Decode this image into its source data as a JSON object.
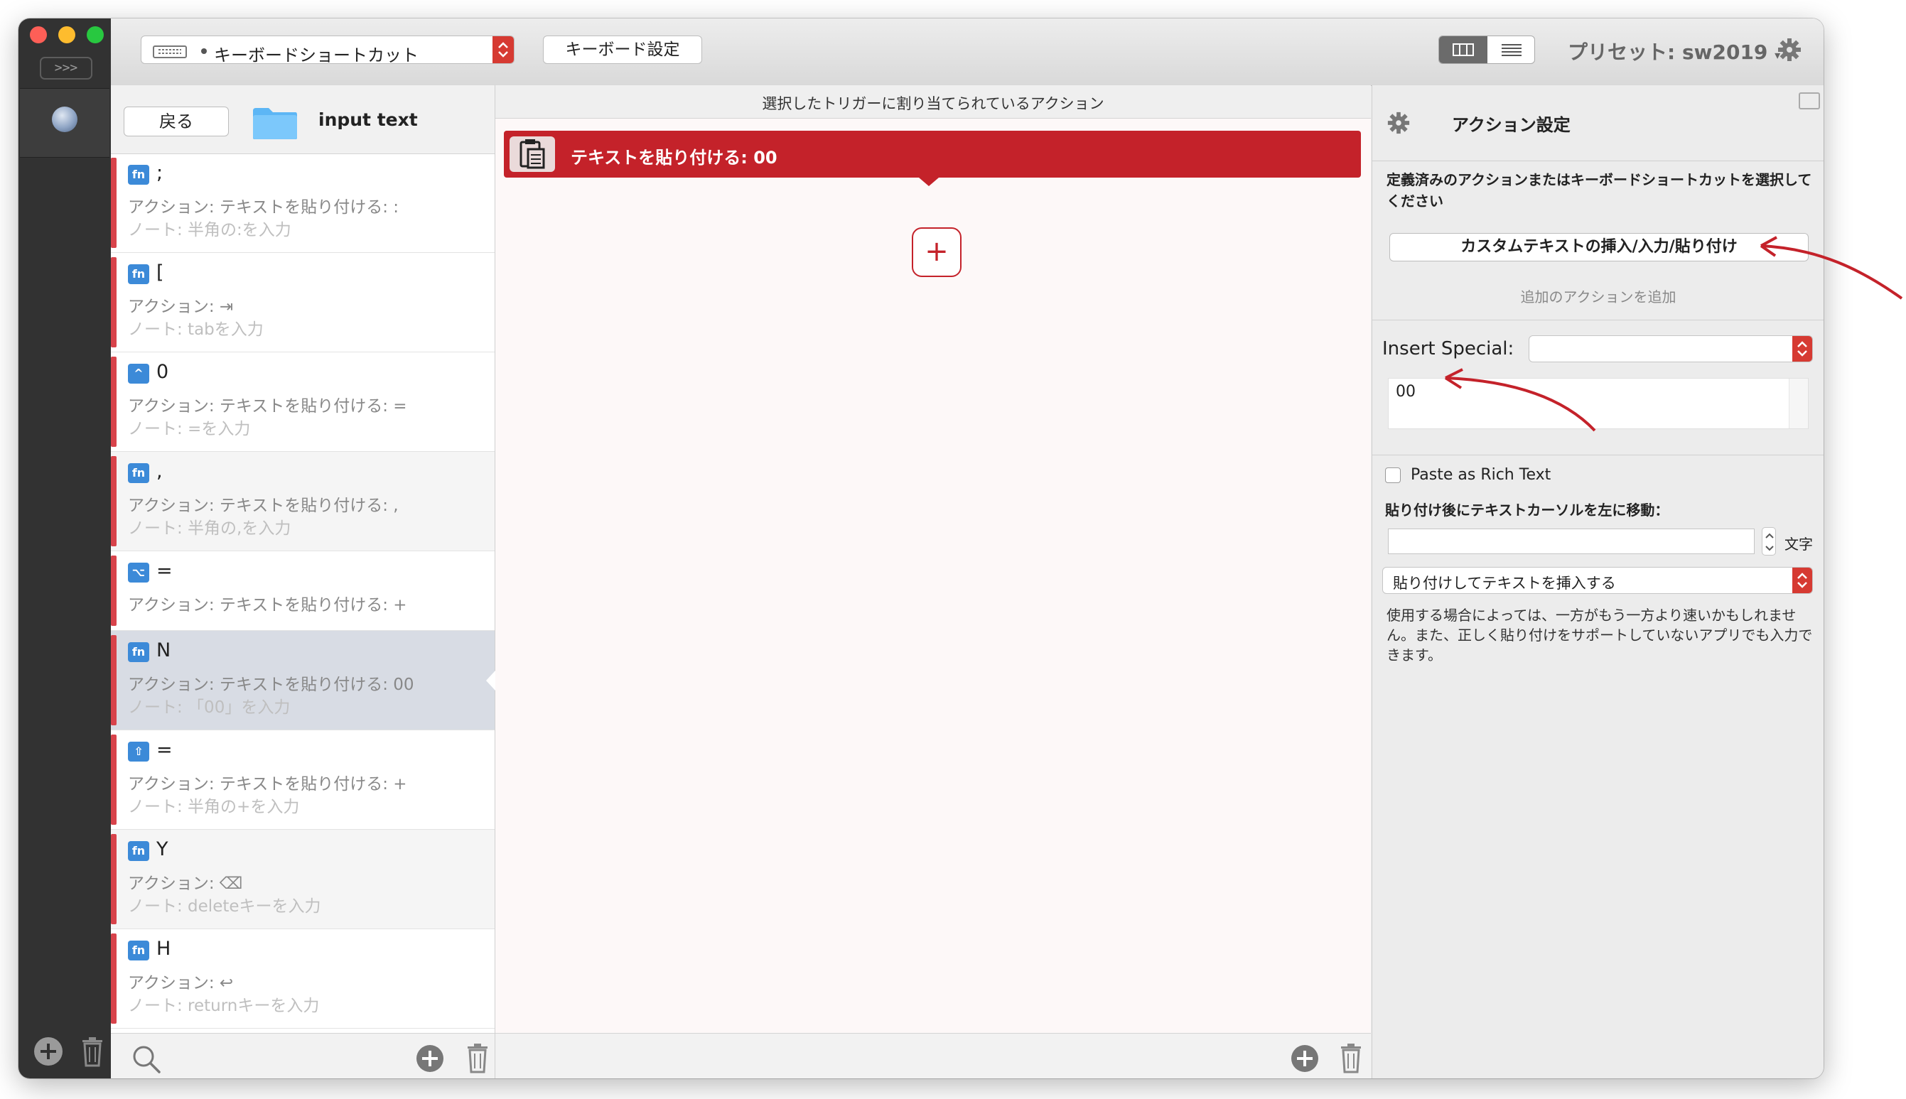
{
  "toolbar": {
    "trigger_type": "キーボードショートカット",
    "keyboard_settings": "キーボード設定",
    "preset_label": "プリセット: sw2019"
  },
  "list": {
    "back_label": "戻る",
    "folder_name": "input text",
    "items": [
      {
        "badge": "fn",
        "key": ";",
        "action": "アクション: テキストを貼り付ける: :",
        "note": "ノート: 半角の:を入力"
      },
      {
        "badge": "fn",
        "key": "[",
        "action": "アクション: ⇥",
        "note": "ノート: tabを入力"
      },
      {
        "badge": "^",
        "key": "0",
        "action": "アクション: テキストを貼り付ける: =",
        "note": "ノート: =を入力"
      },
      {
        "badge": "fn",
        "key": ",",
        "action": "アクション: テキストを貼り付ける: ,",
        "note": "ノート: 半角の,を入力"
      },
      {
        "badge": "⌥",
        "key": "=",
        "action": "アクション: テキストを貼り付ける: +",
        "note": ""
      },
      {
        "badge": "fn",
        "key": "N",
        "action": "アクション: テキストを貼り付ける: 00",
        "note": "ノート: 「00」を入力"
      },
      {
        "badge": "⇧",
        "key": "=",
        "action": "アクション: テキストを貼り付ける: +",
        "note": "ノート: 半角の+を入力"
      },
      {
        "badge": "fn",
        "key": "Y",
        "action": "アクション: ⌫",
        "note": "ノート: deleteキーを入力"
      },
      {
        "badge": "fn",
        "key": "H",
        "action": "アクション: ↩",
        "note": "ノート: returnキーを入力"
      }
    ]
  },
  "middle": {
    "header": "選択したトリガーに割り当てられているアクション",
    "action": "テキストを貼り付ける: 00",
    "add_symbol": "+"
  },
  "right": {
    "title": "アクション設定",
    "description": "定義済みのアクションまたはキーボードショートカットを選択してください",
    "custom_button": "カスタムテキストの挿入/入力/貼り付け",
    "add_action": "追加のアクションを追加",
    "insert_special_label": "Insert Special:",
    "text_value": "00",
    "rich_text_label": "Paste as Rich Text",
    "move_cursor_label": "貼り付け後にテキストカーソルを左に移動：",
    "unit_label": "文字",
    "paste_mode": "貼り付けしてテキストを挿入する",
    "note": "使用する場合によっては、一方がもう一方より速いかもしれません。また、正しく貼り付けをサポートしていないアプリでも入力できます。"
  },
  "colors": {
    "accent_red": "#c4222a",
    "badge_blue": "#3c8ad8",
    "sidebar_dark": "#323232"
  }
}
